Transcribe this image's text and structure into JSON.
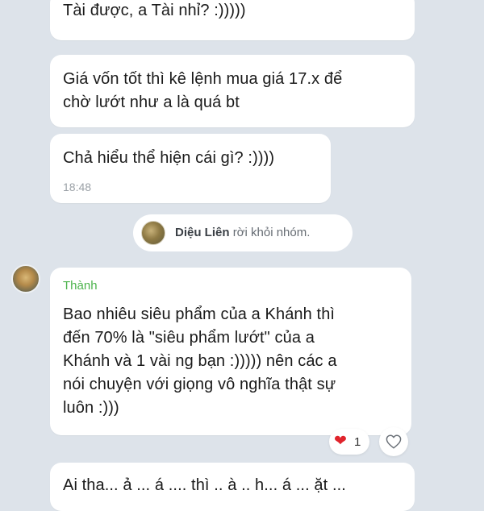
{
  "messages": [
    {
      "text": "Tài được, a Tài nhỉ? :)))))"
    },
    {
      "text": "Giá vốn tốt thì kê lệnh mua giá 17.x để\nchờ lướt như a là quá bt"
    },
    {
      "text": "Chả hiểu thể hiện cái gì? :))))",
      "time": "18:48"
    },
    {
      "sender": "Thành",
      "text": "Bao nhiêu siêu phẩm của a Khánh thì\nđến 70% là \"siêu phẩm lướt\" của a\nKhánh và 1 vài ng bạn :))))) nên các a\nnói chuyện với giọng vô nghĩa thật sự\nluôn :)))",
      "reaction_count": "1"
    },
    {
      "text": "Ai tha... ả ... á .... thì .. à .. h... á ... ặt ..."
    }
  ],
  "system_notice": {
    "name": "Diệu Liên",
    "action": "rời khỏi nhóm."
  },
  "icons": {
    "reaction": "red-heart-emoji",
    "like": "heart-outline-icon"
  },
  "colors": {
    "background": "#dde3ea",
    "sender_name": "#4bb34b",
    "heart": "#e0242c"
  }
}
